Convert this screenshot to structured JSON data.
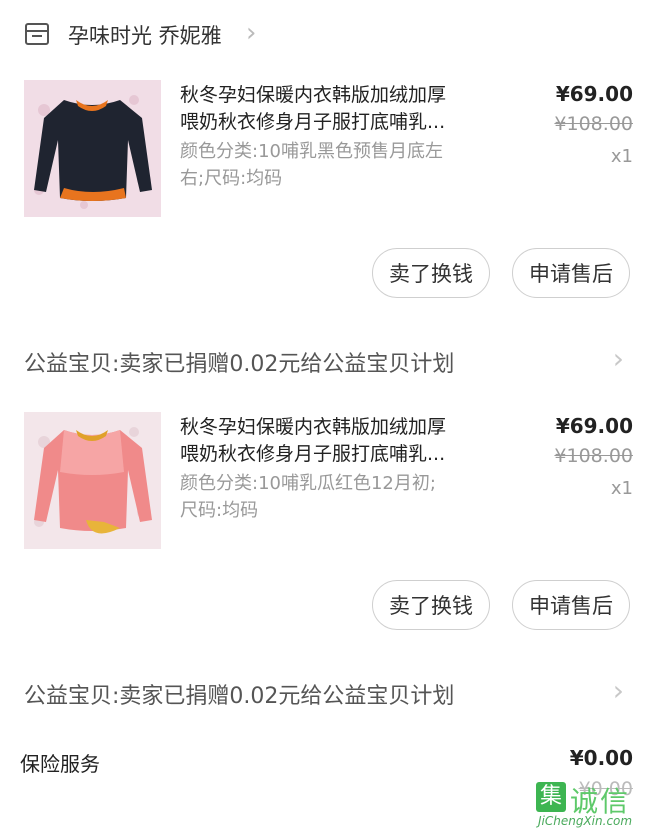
{
  "shop": {
    "name": "孕味时光 乔妮雅",
    "icon": "store-icon",
    "chevron": "›"
  },
  "items": [
    {
      "title_line1": "秋冬孕妇保暖内衣韩版加绒加厚",
      "title_line2": "喂奶秋衣修身月子服打底哺乳...",
      "sku_line1": "颜色分类:10哺乳黑色预售月底左",
      "sku_line2": "右;尺码:均码",
      "price": "¥69.00",
      "original_price": "¥108.00",
      "quantity": "x1",
      "image_color": "#1f2430",
      "buttons": {
        "resell": "卖了换钱",
        "after_sale": "申请售后"
      }
    },
    {
      "title_line1": "秋冬孕妇保暖内衣韩版加绒加厚",
      "title_line2": "喂奶秋衣修身月子服打底哺乳...",
      "sku_line1": "颜色分类:10哺乳瓜红色12月初;",
      "sku_line2": "尺码:均码",
      "price": "¥69.00",
      "original_price": "¥108.00",
      "quantity": "x1",
      "image_color": "#f08a8a",
      "buttons": {
        "resell": "卖了换钱",
        "after_sale": "申请售后"
      }
    }
  ],
  "charity": {
    "text": "公益宝贝:卖家已捐赠0.02元给公益宝贝计划",
    "chevron": "›"
  },
  "insurance": {
    "label": "保险服务",
    "price": "¥0.00",
    "original_price": "¥0.00"
  },
  "watermark": {
    "box_char": "集",
    "chars": "诚信",
    "url": "JiChengXin.com"
  }
}
